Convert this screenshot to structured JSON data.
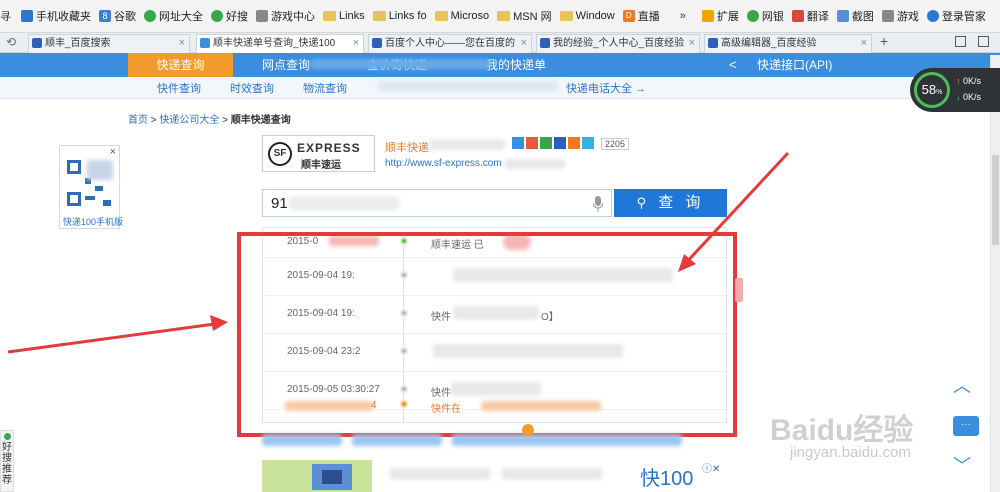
{
  "bookmarks": [
    {
      "label": "手机收藏夹",
      "icon": "phone-bookmark-icon"
    },
    {
      "label": "谷歌",
      "icon": "google-icon"
    },
    {
      "label": "网址大全",
      "icon": "url-directory-icon"
    },
    {
      "label": "好搜",
      "icon": "haosou-icon"
    },
    {
      "label": "游戏中心",
      "icon": "game-center-icon"
    },
    {
      "label": "Links",
      "icon": "folder-icon"
    },
    {
      "label": "Links fo",
      "icon": "folder-icon"
    },
    {
      "label": "Microso",
      "icon": "folder-icon"
    },
    {
      "label": "MSN 网",
      "icon": "folder-icon"
    },
    {
      "label": "Window",
      "icon": "folder-icon"
    },
    {
      "label": "直播",
      "icon": "live-icon"
    }
  ],
  "bookmarks_left_fragment": "寻",
  "toolbar_right": [
    {
      "label": "扩展",
      "icon": "extension-icon"
    },
    {
      "label": "网银",
      "icon": "bank-icon"
    },
    {
      "label": "翻译",
      "icon": "translate-icon"
    },
    {
      "label": "截图",
      "icon": "screenshot-icon"
    },
    {
      "label": "游戏",
      "icon": "game-icon"
    },
    {
      "label": "登录管家",
      "icon": "login-manager-icon"
    }
  ],
  "tabs": [
    {
      "label": "顺丰_百度搜索",
      "active": false
    },
    {
      "label": "顺丰快递单号查询_快递100",
      "active": true
    },
    {
      "label": "百度个人中心——您在百度的",
      "active": false
    },
    {
      "label": "我的经验_个人中心_百度经验",
      "active": false
    },
    {
      "label": "高级编辑器_百度经验",
      "active": false
    }
  ],
  "nav": {
    "items": [
      "快递查询",
      "网点查询",
      "查价寄快递",
      "我的快递单",
      "快递接口(API)"
    ]
  },
  "subnav": {
    "items": [
      "快件查询",
      "时效查询",
      "物流查询",
      "快递电话大全 →"
    ]
  },
  "breadcrumb": {
    "home": "首页",
    "sep1": ">",
    "list": "快递公司大全",
    "sep2": ">",
    "current": "顺丰快递查询"
  },
  "qr": {
    "caption": "快递100手机版",
    "close": "×"
  },
  "company": {
    "logo_en": "EXPRESS",
    "logo_cn": "顺丰速运",
    "logo_sf": "SF",
    "name": "顺丰快递",
    "url": "http://www.sf-express.com",
    "count": "2205"
  },
  "search": {
    "value": "91",
    "button": "查 询"
  },
  "results": [
    {
      "time": "2015-0",
      "desc": "顺丰速运 已",
      "status": "latest"
    },
    {
      "time": "2015-09-04 19:",
      "desc": "",
      "status": "normal"
    },
    {
      "time": "2015-09-04 19:",
      "desc": "快件",
      "status": "normal"
    },
    {
      "time": "2015-09-04 23:2",
      "desc": "",
      "status": "normal"
    },
    {
      "time": "2015-09-05 03:30:27",
      "desc": "快件",
      "status": "normal"
    },
    {
      "time": "4",
      "desc": "快件在",
      "status": "origin"
    }
  ],
  "result_desc_extra": [
    "快件",
    "O】"
  ],
  "gauge": {
    "percent": "58",
    "unit": "%",
    "up": "0K/s",
    "down": "0K/s"
  },
  "feedback": {
    "label": "好搜推荐"
  },
  "ad": {
    "brand": "快100"
  },
  "watermark": {
    "brand": "Baidu经验",
    "url": "jingyan.baidu.com"
  },
  "colors": {
    "nav": "#3a8ee0",
    "nav_active": "#f39a2c",
    "red_annotation": "#e43a3a",
    "search_button": "#1f77d8"
  }
}
